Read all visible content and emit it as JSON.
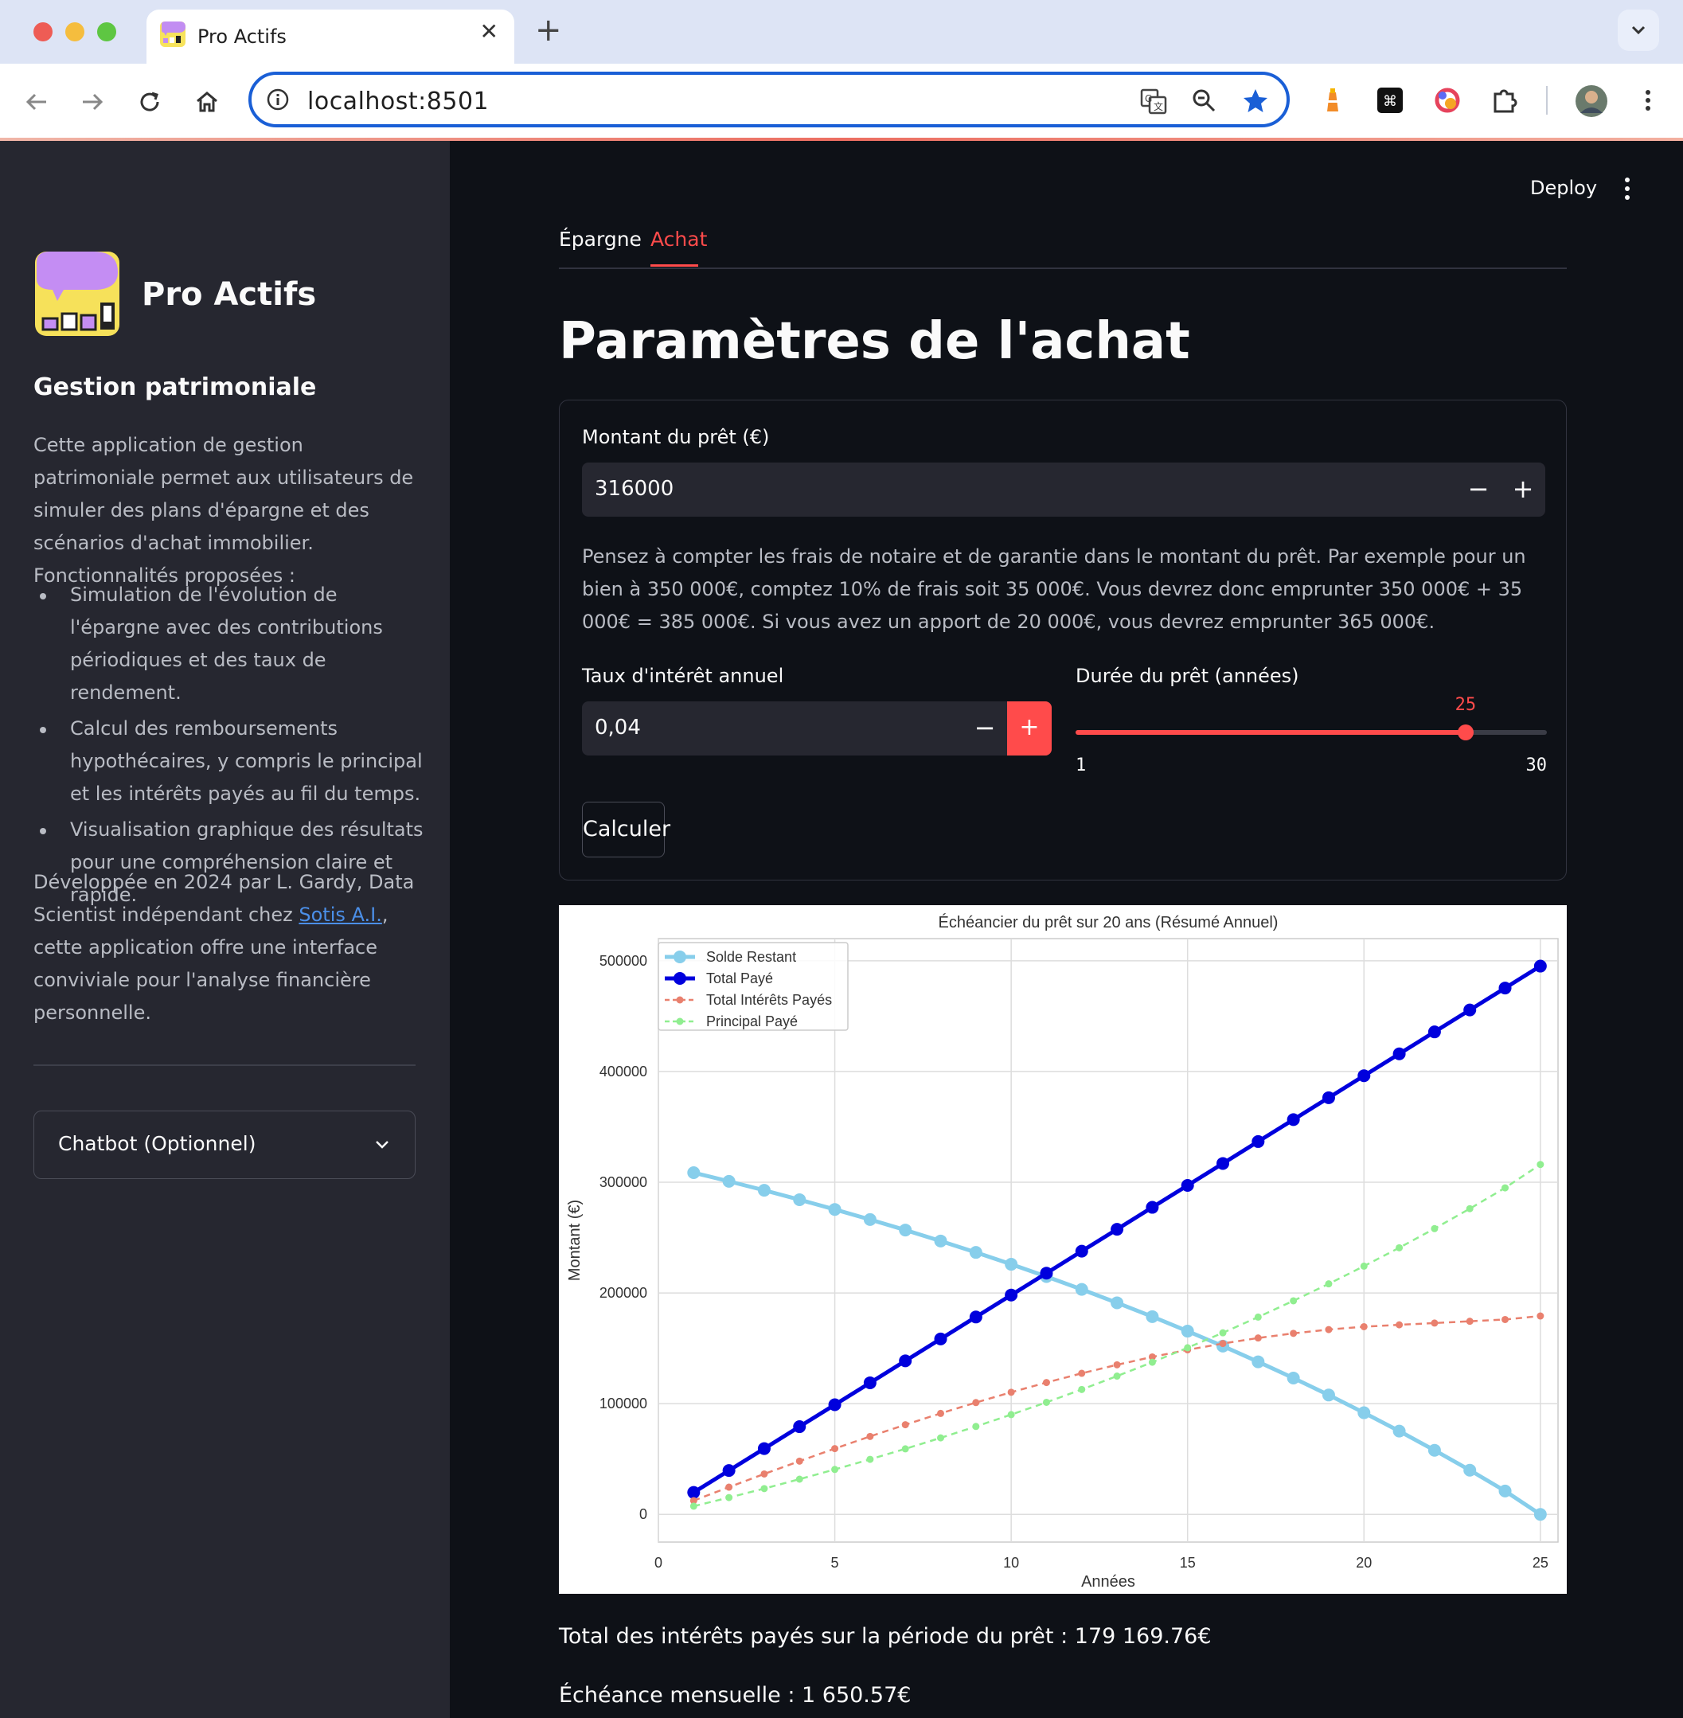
{
  "browser": {
    "tab_title": "Pro Actifs",
    "url": "localhost:8501"
  },
  "sidebar": {
    "app_title": "Pro Actifs",
    "subtitle": "Gestion patrimoniale",
    "description": "Cette application de gestion patrimoniale permet aux utilisateurs de simuler des plans d'épargne et des scénarios d'achat immobilier. Fonctionnalités proposées :",
    "features": [
      "Simulation de l'évolution de l'épargne avec des contributions périodiques et des taux de rendement.",
      "Calcul des remboursements hypothécaires, y compris le principal et les intérêts payés au fil du temps.",
      "Visualisation graphique des résultats pour une compréhension claire et rapide."
    ],
    "dev_before": "Développée en 2024 par L. Gardy, Data Scientist indépendant chez ",
    "dev_link": "Sotis A.I.",
    "dev_after": ", cette application offre une interface conviviale pour l'analyse financière personnelle.",
    "chatbot_label": "Chatbot (Optionnel)"
  },
  "header": {
    "deploy_label": "Deploy"
  },
  "tabs": [
    {
      "label": "Épargne",
      "active": false
    },
    {
      "label": "Achat",
      "active": true
    }
  ],
  "main": {
    "title": "Paramètres de l'achat",
    "loan_label": "Montant du prêt (€)",
    "loan_value": "316000",
    "minus": "−",
    "plus": "+",
    "info": "Pensez à compter les frais de notaire et de garantie dans le montant du prêt. Par exemple pour un bien à 350 000€, comptez 10% de frais soit 35 000€. Vous devrez donc emprunter 350 000€ + 35 000€ = 385 000€. Si vous avez un apport de 20 000€, vous devrez emprunter 365 000€.",
    "rate_label": "Taux d'intérêt annuel",
    "rate_value": "0,04",
    "duration_label": "Durée du prêt (années)",
    "duration_value": 25,
    "duration_min": 1,
    "duration_max": 30,
    "calc_label": "Calculer",
    "total_interest": "Total des intérêts payés sur la période du prêt : 179 169.76€",
    "monthly": "Échéance mensuelle : 1 650.57€"
  },
  "colors": {
    "accent": "#ff4b4b",
    "sidebar_bg": "#262730",
    "main_bg": "#0e1117"
  },
  "chart_data": {
    "type": "line",
    "title": "Échéancier du prêt sur 20 ans (Résumé Annuel)",
    "xlabel": "Années",
    "ylabel": "Montant (€)",
    "xlim": [
      0,
      25.5
    ],
    "ylim": [
      -25000,
      520000
    ],
    "xticks": [
      0,
      5,
      10,
      15,
      20,
      25
    ],
    "yticks": [
      0,
      100000,
      200000,
      300000,
      400000,
      500000
    ],
    "grid": true,
    "legend_position": "top-left",
    "x": [
      1,
      2,
      3,
      4,
      5,
      6,
      7,
      8,
      9,
      10,
      11,
      12,
      13,
      14,
      15,
      16,
      17,
      18,
      19,
      20,
      21,
      22,
      23,
      24,
      25
    ],
    "series": [
      {
        "name": "Solde Restant",
        "color": "#87ceeb",
        "style": "solid-large",
        "values": [
          308600,
          300800,
          292700,
          284200,
          275400,
          266300,
          256800,
          246900,
          236600,
          225900,
          214800,
          203200,
          191100,
          178600,
          165500,
          152000,
          137800,
          123100,
          107800,
          91800,
          75200,
          57900,
          39900,
          21100,
          0
        ]
      },
      {
        "name": "Total Payé",
        "color": "#0000dd",
        "style": "solid-bold",
        "values": [
          19807,
          39614,
          59421,
          79227,
          99034,
          118841,
          138648,
          158455,
          178262,
          198069,
          217876,
          237682,
          257489,
          277296,
          297103,
          316910,
          336717,
          356524,
          376331,
          396137,
          415944,
          435751,
          455558,
          475365,
          495172
        ]
      },
      {
        "name": "Total Intérêts Payés",
        "color": "#e9806e",
        "style": "dashed",
        "values": [
          12400,
          24600,
          36500,
          48100,
          59400,
          70400,
          81000,
          91200,
          101000,
          110300,
          119100,
          127400,
          135100,
          142200,
          148600,
          154300,
          159300,
          163500,
          166900,
          169500,
          171200,
          172800,
          174400,
          176000,
          179170
        ]
      },
      {
        "name": "Principal Payé",
        "color": "#90ee90",
        "style": "dashed",
        "values": [
          7400,
          15200,
          23300,
          31800,
          40600,
          49700,
          59200,
          69100,
          79400,
          90100,
          101200,
          112800,
          124900,
          137400,
          150500,
          164000,
          178200,
          192900,
          208200,
          224200,
          240800,
          258100,
          276100,
          294900,
          316000
        ]
      }
    ]
  }
}
